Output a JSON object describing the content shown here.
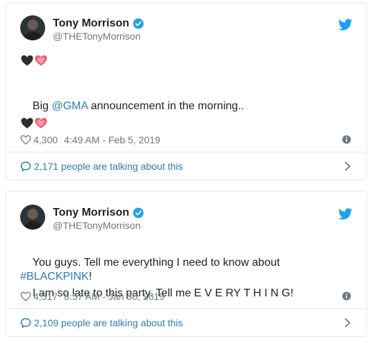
{
  "tweets": [
    {
      "author": {
        "name": "Tony Morrison",
        "handle": "@THETonyMorrison"
      },
      "lines": [
        {
          "parts": [
            {
              "text": "Big "
            },
            {
              "text": "@GMA",
              "link": true
            },
            {
              "text": " announcement in the morning.."
            }
          ]
        }
      ],
      "emoji_rows": [
        [
          "black-heart-icon",
          "sparkling-heart-icon"
        ],
        [
          "black-heart-icon",
          "sparkling-heart-icon"
        ]
      ],
      "likes": "4,300",
      "timestamp": "4:49 AM - Feb 5, 2019",
      "talking": "2,171 people are talking about this"
    },
    {
      "author": {
        "name": "Tony Morrison",
        "handle": "@THETonyMorrison"
      },
      "lines": [
        {
          "parts": [
            {
              "text": "You guys. Tell me everything I need to know about "
            },
            {
              "text": "#BLACKPINK",
              "link": true
            },
            {
              "text": "!"
            }
          ]
        },
        {
          "parts": [
            {
              "text": "I am so late to this party. Tell me E V E RY T H I N G!"
            }
          ]
        }
      ],
      "likes": "4,517",
      "timestamp": "8:57 AM - Jan 30, 2019",
      "talking": "2,109 people are talking about this"
    }
  ],
  "colors": {
    "link": "#2b7bb9",
    "meta": "#697882",
    "border": "#e1e8ed",
    "verified": "#1da1f2",
    "heart_pink": "#f0566b"
  }
}
